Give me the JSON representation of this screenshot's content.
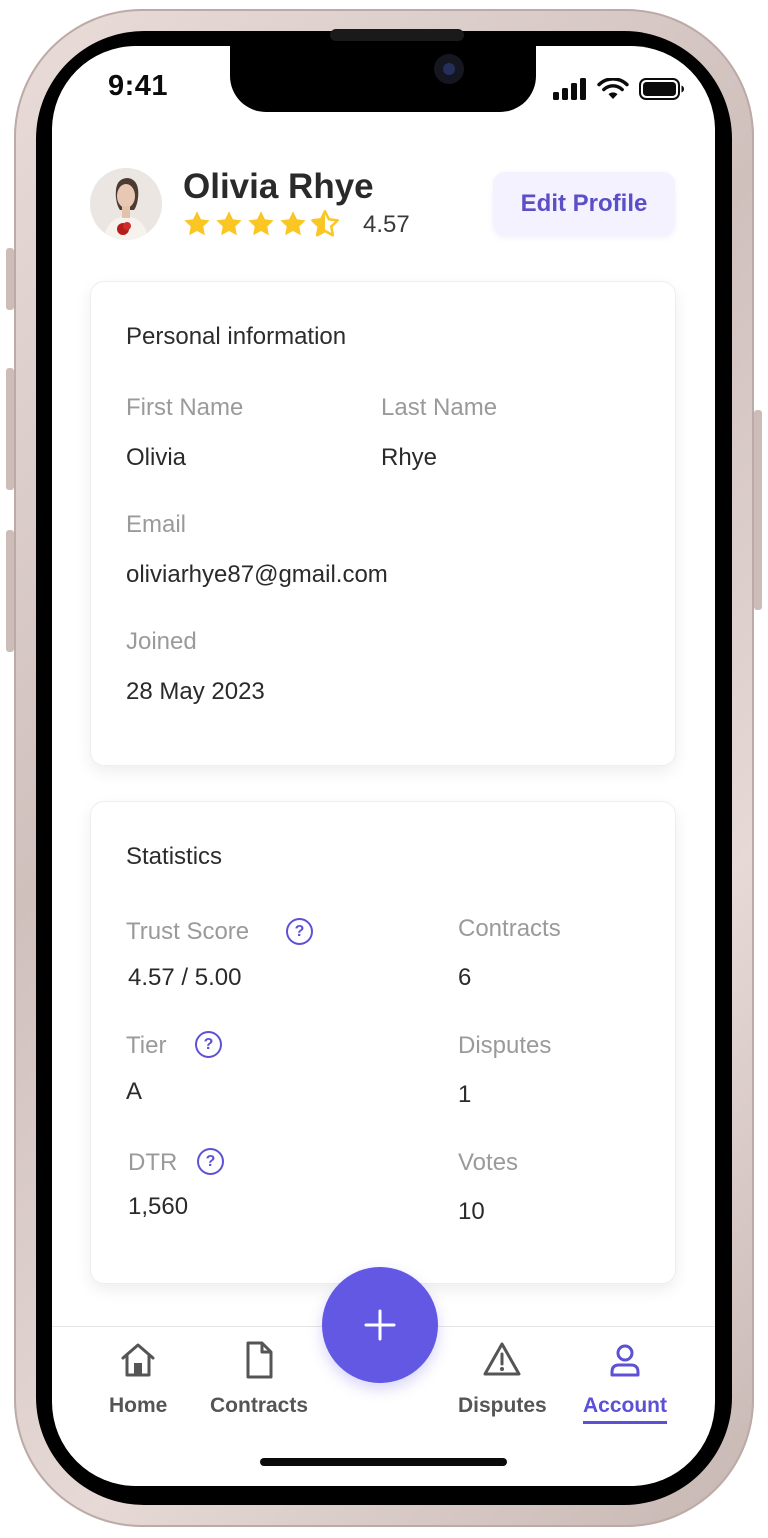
{
  "status_bar": {
    "time": "9:41"
  },
  "profile": {
    "name": "Olivia Rhye",
    "rating": 4.57,
    "rating_display": "4.57",
    "stars_filled": 4.5,
    "stars_total": 5,
    "edit_label": "Edit Profile"
  },
  "personal_info": {
    "title": "Personal information",
    "first_name_label": "First Name",
    "first_name_value": "Olivia",
    "last_name_label": "Last Name",
    "last_name_value": "Rhye",
    "email_label": "Email",
    "email_value": "oliviarhye87@gmail.com",
    "joined_label": "Joined",
    "joined_value": "28 May 2023"
  },
  "statistics": {
    "title": "Statistics",
    "help_glyph": "?",
    "trust_score_label": "Trust Score",
    "trust_score_value": "4.57 / 5.00",
    "tier_label": "Tier",
    "tier_value": "A",
    "dtr_label": "DTR",
    "dtr_value": "1,560",
    "contracts_label": "Contracts",
    "contracts_value": "6",
    "disputes_label": "Disputes",
    "disputes_value": "1",
    "votes_label": "Votes",
    "votes_value": "10"
  },
  "nav": {
    "items": [
      {
        "label": "Home",
        "icon": "home-icon",
        "active": false
      },
      {
        "label": "Contracts",
        "icon": "file-icon",
        "active": false
      },
      {
        "label": "Disputes",
        "icon": "warning-icon",
        "active": false
      },
      {
        "label": "Account",
        "icon": "user-icon",
        "active": true
      }
    ],
    "fab_icon": "plus-icon"
  },
  "colors": {
    "accent": "#6258e3",
    "accent_text": "#5b4fc7",
    "star": "#f9c623",
    "label_gray": "#9a9a9a",
    "text_dark": "#2a2a2a"
  }
}
